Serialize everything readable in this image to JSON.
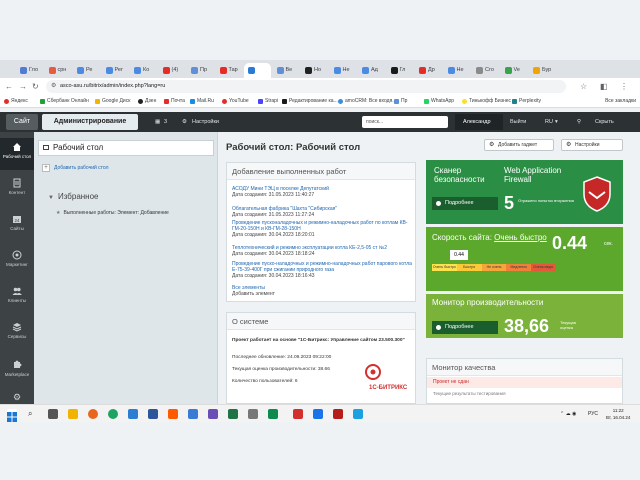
{
  "browser": {
    "tabs": [
      {
        "label": "Гло",
        "color": "#4f7bd1"
      },
      {
        "label": "срн",
        "color": "#e95a3e"
      },
      {
        "label": "Ре",
        "color": "#4b8be3"
      },
      {
        "label": "Рег",
        "color": "#4b8be3"
      },
      {
        "label": "Ко",
        "color": "#4b8be3"
      },
      {
        "label": "(4)",
        "color": "#e52d27"
      },
      {
        "label": "Пр",
        "color": "#5f8fd6"
      },
      {
        "label": "Тар",
        "color": "#e52d27"
      },
      {
        "label": "",
        "color": "#2a7bd6"
      },
      {
        "label": "Ве",
        "color": "#5f8fd6"
      },
      {
        "label": "Но",
        "color": "#222222"
      },
      {
        "label": "Не",
        "color": "#4b8be3"
      },
      {
        "label": "Ад",
        "color": "#4b8be3"
      },
      {
        "label": "Гл",
        "color": "#1a1a1a"
      },
      {
        "label": "Др",
        "color": "#e52d27"
      },
      {
        "label": "Не",
        "color": "#4b8be3"
      },
      {
        "label": "Сго",
        "color": "#8a8a8a"
      },
      {
        "label": "Ve",
        "color": "#37a34a"
      },
      {
        "label": "Бур",
        "color": "#f0a500"
      }
    ],
    "url": "asco-asu.ru/bitrix/admin/index.php?lang=ru",
    "bookmarks": [
      {
        "label": "Яндекс",
        "color": "#e52d27"
      },
      {
        "label": "Сбербанк Онлайн",
        "color": "#21a038"
      },
      {
        "label": "Google Диск",
        "color": "#f4b400"
      },
      {
        "label": "Дзен",
        "color": "#222222"
      },
      {
        "label": "Почта",
        "color": "#e52d27"
      },
      {
        "label": "Mail.Ru",
        "color": "#168de2"
      },
      {
        "label": "YouTube",
        "color": "#e52d27"
      },
      {
        "label": "Strapi",
        "color": "#4945ff"
      },
      {
        "label": "Редактирование ка...",
        "color": "#1a1a1a"
      },
      {
        "label": "amoCRM: Все входя...",
        "color": "#3d8fd6"
      },
      {
        "label": "Пр",
        "color": "#5f8fd6"
      },
      {
        "label": "WhatsApp",
        "color": "#25d366"
      },
      {
        "label": "Тинькофф Бизнес",
        "color": "#ffdd2d"
      },
      {
        "label": "Perplexity",
        "color": "#20808d"
      }
    ],
    "all_bookmarks": "Все закладки"
  },
  "admin": {
    "site_btn": "Сайт",
    "admin_btn": "Администрирование",
    "notif_count": "3",
    "settings": "Настройки",
    "search_placeholder": "поиск...",
    "user": "Александр",
    "logout": "Выйти",
    "lang": "RU",
    "hide": "Скрыть"
  },
  "leftnav": [
    {
      "label": "Рабочий стол",
      "active": true
    },
    {
      "label": "Контент",
      "active": false
    },
    {
      "label": "Сайты",
      "active": false
    },
    {
      "label": "Маркетинг",
      "active": false
    },
    {
      "label": "Клиенты",
      "active": false
    },
    {
      "label": "Сервисы",
      "active": false
    },
    {
      "label": "Marketplace",
      "active": false
    },
    {
      "label": "Настройки",
      "active": false
    }
  ],
  "sidebar": {
    "title": "Рабочий стол",
    "add": "Добавить рабочий стол",
    "favorites": "Избранное",
    "fav_item": "Выполненные работы: Элемент: Добавление"
  },
  "main": {
    "title": "Рабочий стол: Рабочий стол",
    "add_gadget": "Добавить гаджет",
    "settings": "Настройки",
    "recent": {
      "title": "Добавление выполненных работ",
      "items": [
        {
          "title": "АСОДУ Мини ТЭЦ в поселке Депутатский",
          "date": "Дата создания: 31.05.2023 11:40:27"
        },
        {
          "title": "Облагательная фабрика \"Шахта \"Сибирская\"",
          "date": "Дата создания: 31.05.2023 11:27:24"
        },
        {
          "title": "Проведение пусконаладочных и режимно-наладочных работ по котлам КВ-ГМ-20-150Н и КВ-ГМ-28-150Н",
          "date": "Дата создания: 30.04.2023 18:20:01"
        },
        {
          "title": "Теплотехнический и режимно эксплуатации котла КЕ-2,5-05 ст №2",
          "date": "Дата создания: 30.04.2023 18:18:24"
        },
        {
          "title": "Проведение пуско-наладочных и режимно-наладочных работ парового котла Е-75-39-400Г при сжигании природного газа",
          "date": "Дата создания: 30.04.2023 18:16:43"
        }
      ],
      "all": "Все элементы",
      "add": "Добавить элемент"
    },
    "system": {
      "title": "О системе",
      "line1": "Проект работает на основе \"1С-Битрикс: Управление сайтом 23.500.300\"",
      "last_update": "Последнее обновление: 24.09.2023 09:22:00",
      "perf": "Текущая оценка производительности: 38.66",
      "users": "Количество пользователей: 6",
      "logo": "1С-БИТРИКС"
    },
    "security": {
      "title": "Сканер безопасности",
      "waf": "Web Application Firewall",
      "details": "Подробнее",
      "count": "5",
      "count_label": "Отражено попыток вторжения"
    },
    "speed": {
      "title": "Скорость сайта:",
      "status": "Очень быстро",
      "value": "0.44",
      "unit": "сек.",
      "marker": "0.44",
      "scale": [
        "Очень быстро",
        "Быстро",
        "Не очень",
        "Медленно",
        "Очень медл."
      ]
    },
    "perf": {
      "title": "Монитор производительности",
      "details": "Подробнее",
      "value": "38,66",
      "label": "Текущая оценка"
    },
    "quality": {
      "title": "Монитор качества",
      "status": "Проект не сдан",
      "sub": "Текущие результаты тестирования"
    }
  },
  "taskbar": {
    "lang": "РУС",
    "time": "11:22",
    "date": "Вт, 16.04.24"
  }
}
